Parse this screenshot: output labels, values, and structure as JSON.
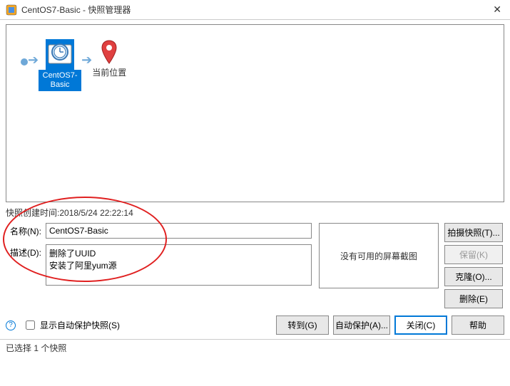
{
  "window": {
    "title": "CentOS7-Basic - 快照管理器"
  },
  "tree": {
    "snapshot_name": "CentOS7-Basic",
    "current_location": "当前位置"
  },
  "details": {
    "timestamp_label": "快照创建时间:",
    "timestamp_value": "2018/5/24 22:22:14",
    "name_label": "名称(N):",
    "name_value": "CentOS7-Basic",
    "desc_label": "描述(D):",
    "desc_value": "删除了UUID\n安装了阿里yum源",
    "no_screenshot": "没有可用的屏幕截图"
  },
  "buttons": {
    "take": "拍摄快照(T)...",
    "keep": "保留(K)",
    "clone": "克隆(O)...",
    "delete": "删除(E)",
    "goto": "转到(G)",
    "autoprotect": "自动保护(A)...",
    "close": "关闭(C)",
    "help": "帮助"
  },
  "checkbox": {
    "show_autoprotect": "显示自动保护快照(S)"
  },
  "status": {
    "text": "已选择 1 个快照"
  }
}
